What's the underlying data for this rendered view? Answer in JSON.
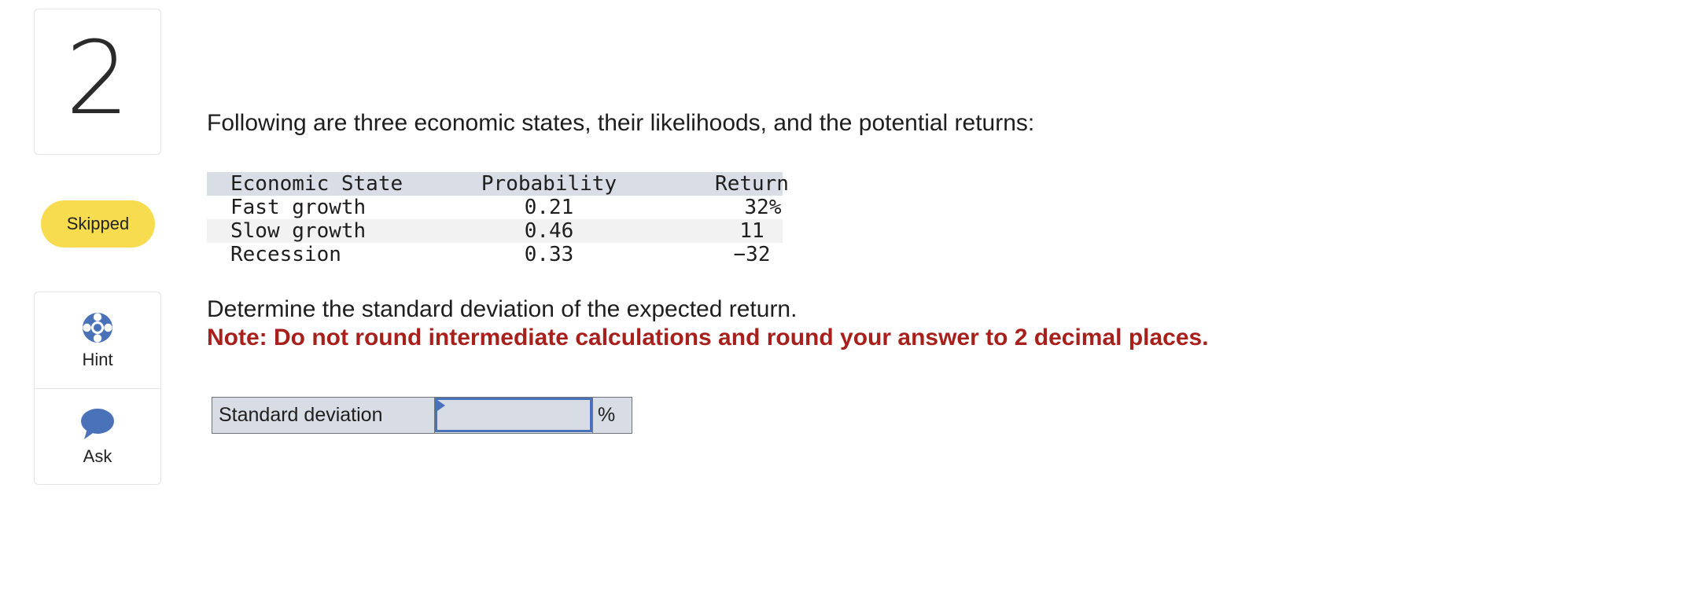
{
  "question_number": "2",
  "status": "Skipped",
  "tools": {
    "hint_label": "Hint",
    "ask_label": "Ask"
  },
  "intro": "Following are three economic states, their likelihoods, and the potential returns:",
  "table": {
    "headers": [
      "Economic State",
      "Probability",
      "Return"
    ],
    "rows": [
      {
        "state": "Fast growth",
        "probability": "0.21",
        "return": "32%"
      },
      {
        "state": "Slow growth",
        "probability": "0.46",
        "return": "11"
      },
      {
        "state": "Recession",
        "probability": "0.33",
        "return": "−32"
      }
    ]
  },
  "question": "Determine the standard deviation of the expected return.",
  "note": "Note: Do not round intermediate calculations and round your answer to 2 decimal places.",
  "answer": {
    "label": "Standard deviation",
    "value": "",
    "unit": "%"
  },
  "colors": {
    "badge": "#f7dc4f",
    "note": "#a8201c",
    "input_border": "#4a72b8",
    "icon": "#4a72b8"
  }
}
